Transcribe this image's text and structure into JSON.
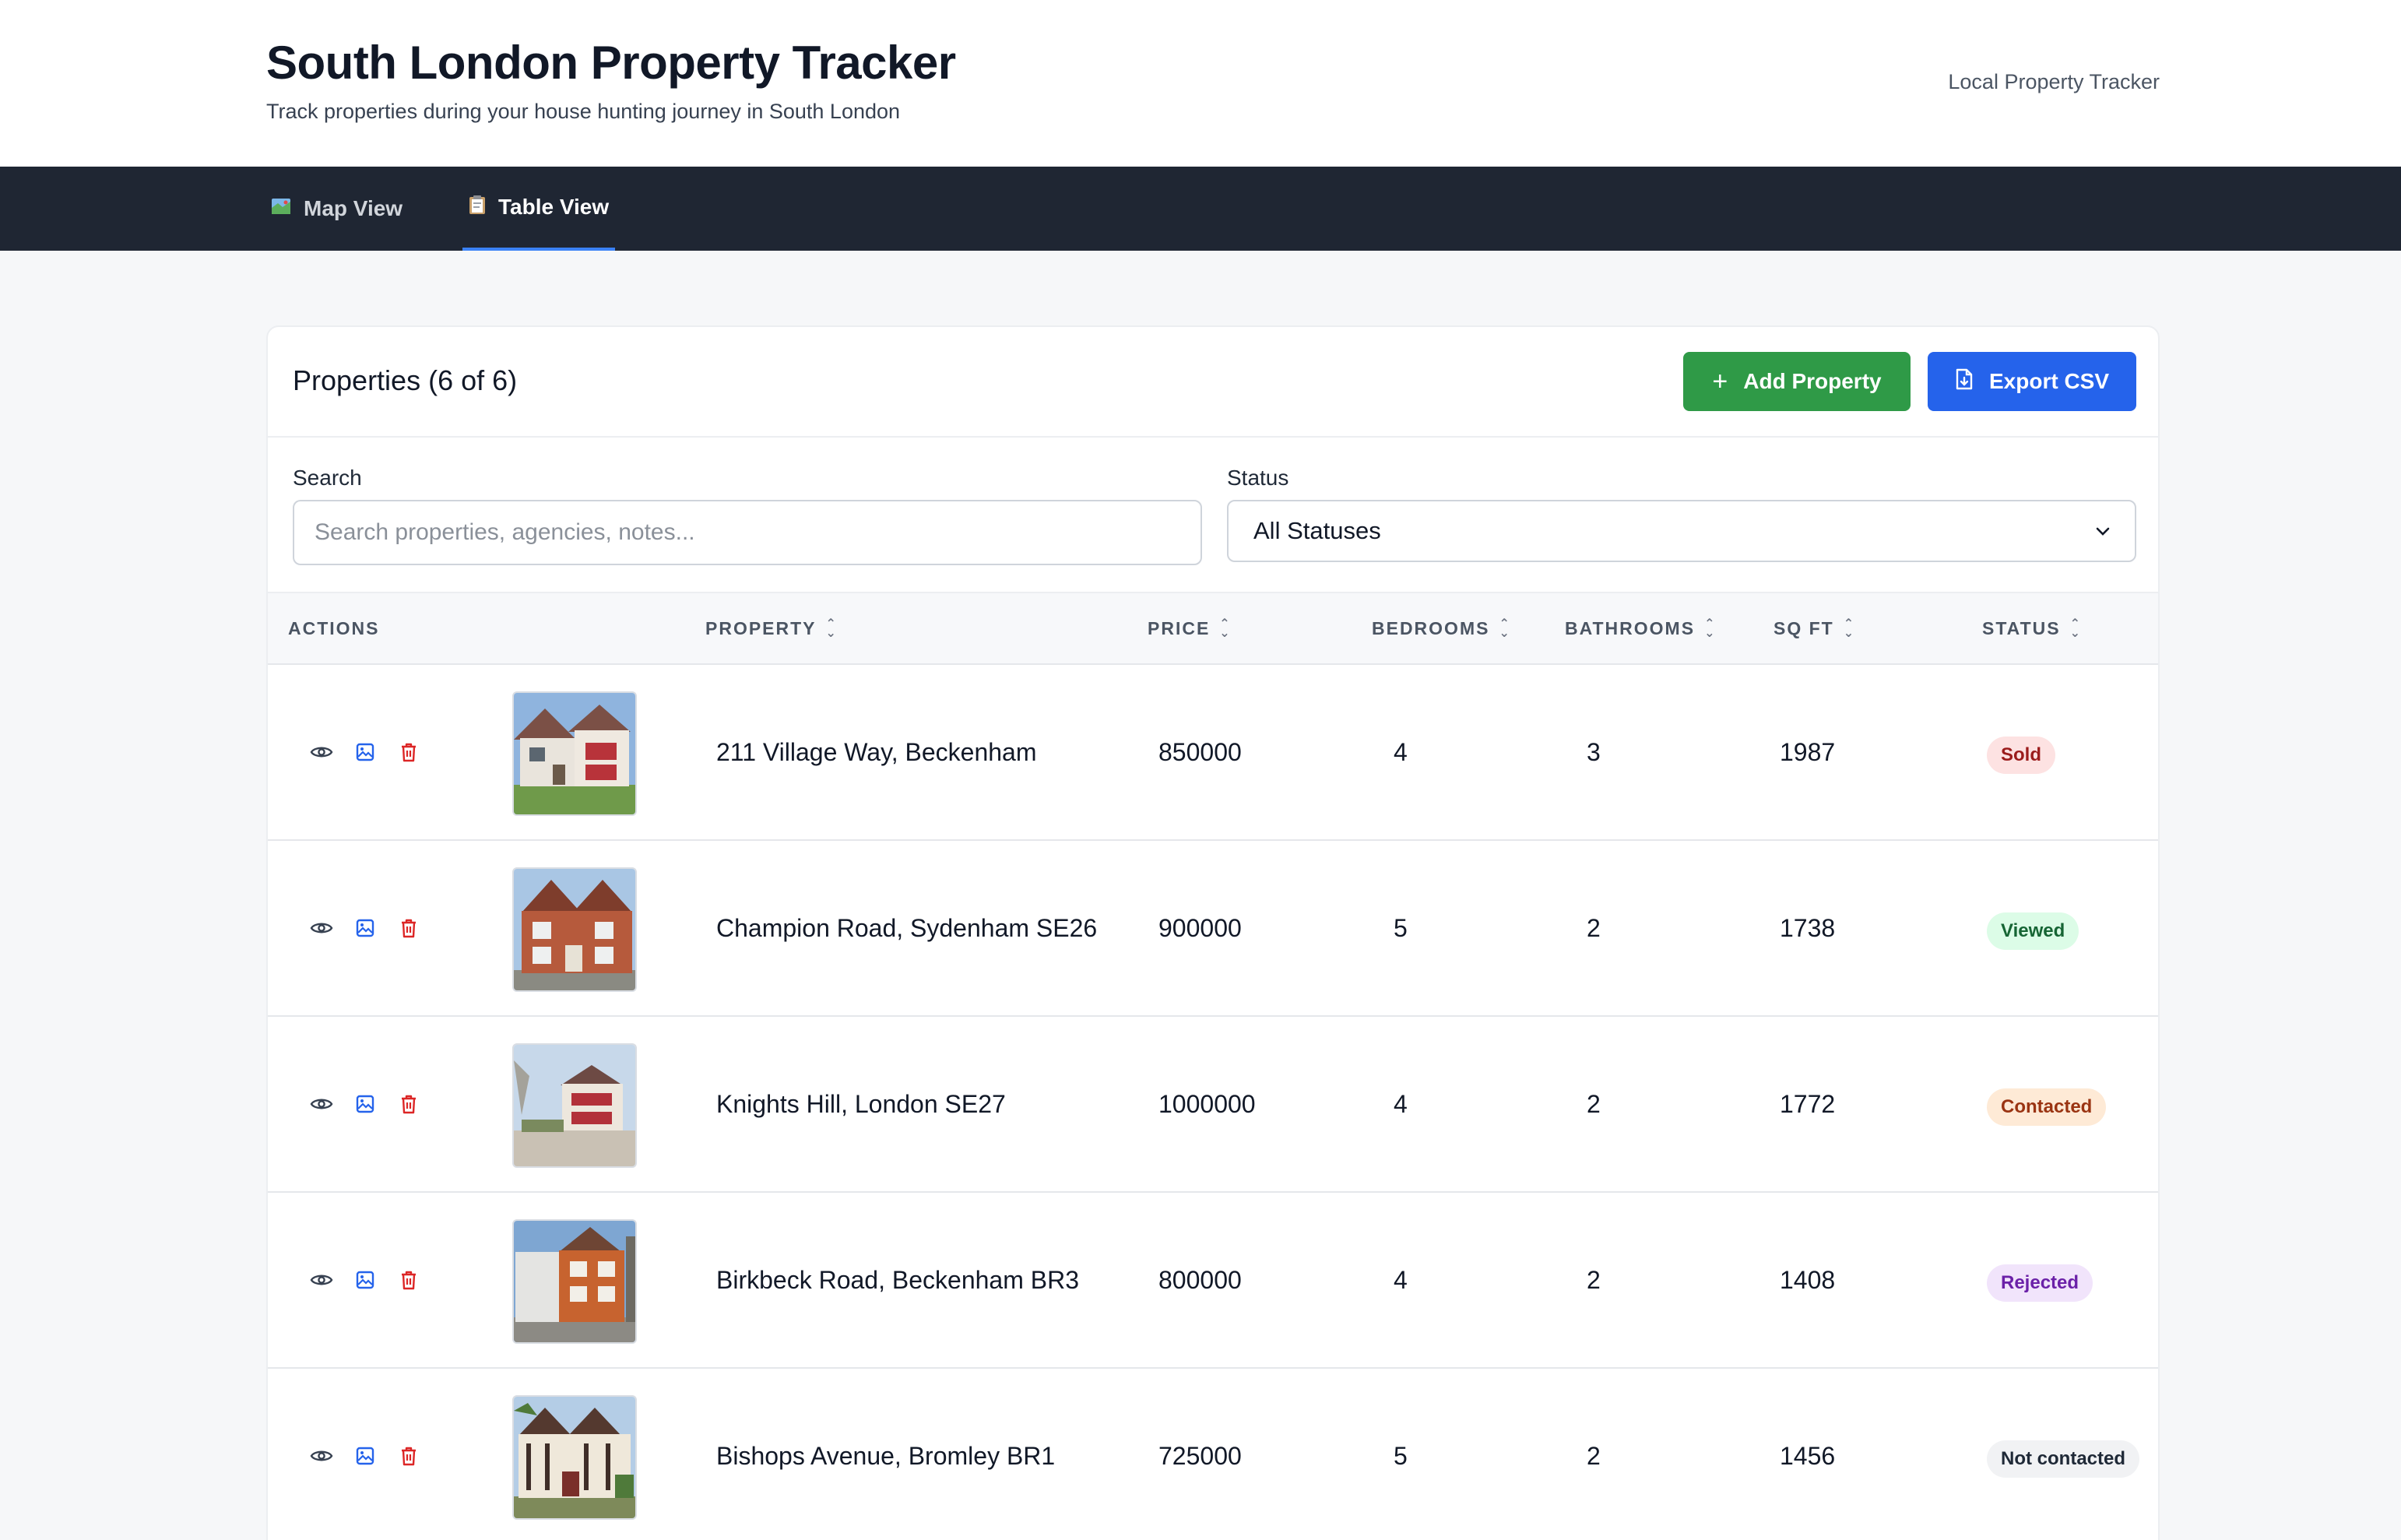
{
  "header": {
    "title": "South London Property Tracker",
    "subtitle": "Track properties during your house hunting journey in South London",
    "right_label": "Local Property Tracker"
  },
  "nav": {
    "tabs": [
      {
        "label": "Map View",
        "icon": "map-icon",
        "active": false
      },
      {
        "label": "Table View",
        "icon": "clipboard-icon",
        "active": true
      }
    ]
  },
  "card": {
    "title": "Properties (6 of 6)",
    "add_label": "Add Property",
    "export_label": "Export CSV"
  },
  "filters": {
    "search_label": "Search",
    "search_placeholder": "Search properties, agencies, notes...",
    "status_label": "Status",
    "status_value": "All Statuses"
  },
  "table": {
    "columns": [
      "ACTIONS",
      "PROPERTY",
      "PRICE",
      "BEDROOMS",
      "BATHROOMS",
      "SQ FT",
      "STATUS"
    ],
    "rows": [
      {
        "property": "211 Village Way, Beckenham",
        "price": "850000",
        "bedrooms": "4",
        "bathrooms": "3",
        "sqft": "1987",
        "status": "Sold"
      },
      {
        "property": "Champion Road, Sydenham SE26",
        "price": "900000",
        "bedrooms": "5",
        "bathrooms": "2",
        "sqft": "1738",
        "status": "Viewed"
      },
      {
        "property": "Knights Hill, London SE27",
        "price": "1000000",
        "bedrooms": "4",
        "bathrooms": "2",
        "sqft": "1772",
        "status": "Contacted"
      },
      {
        "property": "Birkbeck Road, Beckenham BR3",
        "price": "800000",
        "bedrooms": "4",
        "bathrooms": "2",
        "sqft": "1408",
        "status": "Rejected"
      },
      {
        "property": "Bishops Avenue, Bromley BR1",
        "price": "725000",
        "bedrooms": "5",
        "bathrooms": "2",
        "sqft": "1456",
        "status": "Not contacted"
      }
    ]
  },
  "colors": {
    "nav_bg": "#1f2633",
    "accent_blue": "#2563eb",
    "accent_green": "#2f9a47",
    "delete_red": "#dc2626",
    "badge_sold": "#fde2e2",
    "badge_viewed": "#dcfce7",
    "badge_contacted": "#feead6",
    "badge_rejected": "#f1e4fb",
    "badge_not_contacted": "#f1f2f4"
  }
}
